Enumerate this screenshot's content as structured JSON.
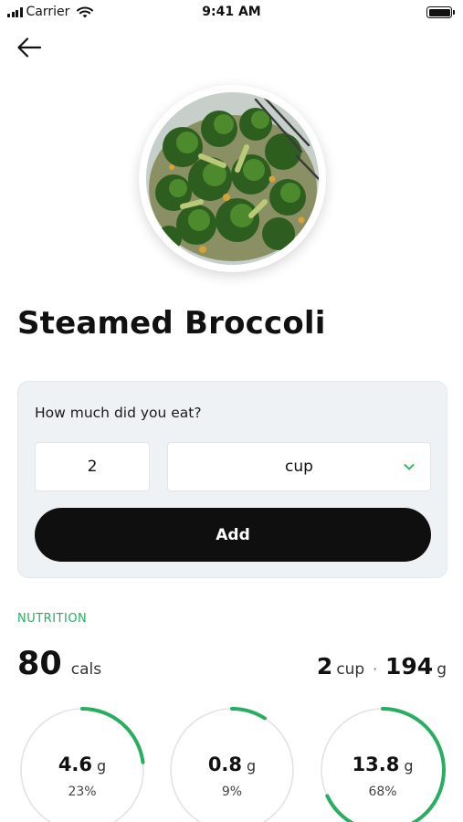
{
  "status_bar": {
    "carrier": "Carrier",
    "time": "9:41 AM"
  },
  "icons": {
    "back": "arrow-left-icon",
    "signal": "signal-icon",
    "wifi": "wifi-icon",
    "battery": "battery-icon",
    "chevron": "chevron-down-icon"
  },
  "food": {
    "title": "Steamed Broccoli"
  },
  "portion": {
    "question": "How much did you eat?",
    "quantity": "2",
    "unit": "cup",
    "add_label": "Add"
  },
  "nutrition": {
    "section_label": "NUTRITION",
    "calories": "80",
    "calories_unit": "cals",
    "serving_qty": "2",
    "serving_unit": "cup",
    "separator": "·",
    "serving_weight": "194",
    "serving_weight_unit": "g",
    "macros": [
      {
        "value": "4.6",
        "unit": "g",
        "percent_label": "23%",
        "percent": 23
      },
      {
        "value": "0.8",
        "unit": "g",
        "percent_label": "9%",
        "percent": 9
      },
      {
        "value": "13.8",
        "unit": "g",
        "percent_label": "68%",
        "percent": 68
      }
    ]
  },
  "colors": {
    "accent": "#27ae60",
    "ring_track": "#e3e3e3",
    "button": "#0f0f0f",
    "card": "#eef2f5"
  }
}
